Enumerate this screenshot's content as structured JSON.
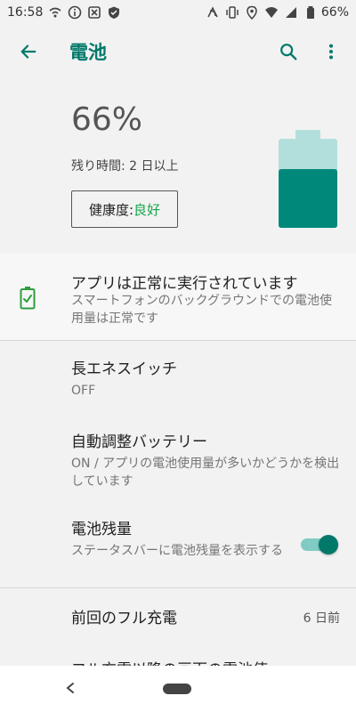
{
  "status_bar": {
    "time": "16:58",
    "battery_percent": "66%",
    "left_icons": [
      "wifi-calling-icon",
      "info-icon",
      "x-app-icon",
      "shield-icon"
    ],
    "right_icons": [
      "nfc-icon",
      "vibrate-icon",
      "location-icon",
      "wifi-icon",
      "signal-icon",
      "battery-icon"
    ]
  },
  "app_bar": {
    "title": "電池",
    "back_icon": "arrow-back-icon",
    "actions": [
      "search-icon",
      "more-vert-icon"
    ]
  },
  "hero": {
    "percent": "66%",
    "remaining": "残り時間: 2 日以上",
    "health_label": "健康度:",
    "health_value": "良好",
    "battery_level": 0.66,
    "colors": {
      "fill": "#00897b",
      "empty": "#b2dfdb",
      "good": "#17a64a",
      "accent": "#00796b"
    }
  },
  "status_card": {
    "title": "アプリは正常に実行されています",
    "subtitle": "スマートフォンのバックグラウンドでの電池使用量は正常です",
    "icon": "battery-check-icon"
  },
  "settings": [
    {
      "title": "長エネスイッチ",
      "summary": "OFF"
    },
    {
      "title": "自動調整バッテリー",
      "summary": "ON / アプリの電池使用量が多いかどうかを検出しています"
    },
    {
      "title": "電池残量",
      "summary": "ステータスバーに電池残量を表示する",
      "toggle": "on"
    }
  ],
  "last_full_charge": {
    "label": "前回のフル充電",
    "value": "6 日前"
  },
  "partial_row": {
    "label": "フル充電以降の画面の電池使"
  },
  "nav_bar": {
    "icons": [
      "nav-back-icon",
      "nav-home-pill"
    ]
  }
}
